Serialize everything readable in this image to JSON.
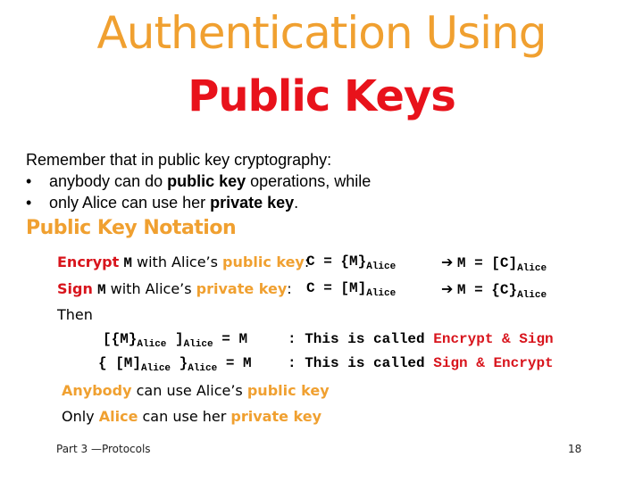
{
  "title": {
    "line1": "Authentication Using",
    "line2": "Public Keys"
  },
  "intro": {
    "lead": "Remember that in public key cryptography:",
    "bullets": [
      {
        "marker": "•",
        "pre": "anybody can do ",
        "bold": "public key",
        "post": " operations, while"
      },
      {
        "marker": "•",
        "pre": "only Alice can use her ",
        "bold": "private key",
        "post": "."
      }
    ]
  },
  "section_heading": "Public Key Notation",
  "notation": {
    "encrypt": {
      "verb": "Encrypt",
      "m": "M",
      "mid": " with Alice’s ",
      "key": "public key",
      "colon": ":",
      "formula": "C = {M}",
      "sub": "Alice",
      "arrow": "➔",
      "result": "M = [C]",
      "result_sub": "Alice"
    },
    "sign": {
      "verb": "Sign",
      "m": "M",
      "mid": " with Alice’s ",
      "key": "private key",
      "colon": ":",
      "formula": "C = [M]",
      "sub": "Alice",
      "arrow": "➔",
      "result": "M = {C}",
      "result_sub": "Alice"
    },
    "then": "Then"
  },
  "combos": [
    {
      "lhs_a": "[{M}",
      "sub_a": "Alice",
      "lhs_b": " ]",
      "sub_b": "Alice",
      "eq": " = M",
      "desc": ": This is called ",
      "name": "Encrypt & Sign"
    },
    {
      "lhs_a": "{ [M]",
      "sub_a": "Alice",
      "lhs_b": " }",
      "sub_b": "Alice",
      "eq": " = M",
      "desc": ": This is called ",
      "name": "Sign & Encrypt"
    }
  ],
  "summary": [
    {
      "a": "Anybody",
      "b": " can use Alice’s ",
      "c": "public key",
      "lead": ""
    },
    {
      "lead": "Only ",
      "a": "Alice",
      "b": " can use her ",
      "c": "private key"
    }
  ],
  "footer": {
    "left": "Part 3 —Protocols",
    "page": "18"
  },
  "colors": {
    "orange": "#f0a030",
    "red": "#e8121b"
  }
}
